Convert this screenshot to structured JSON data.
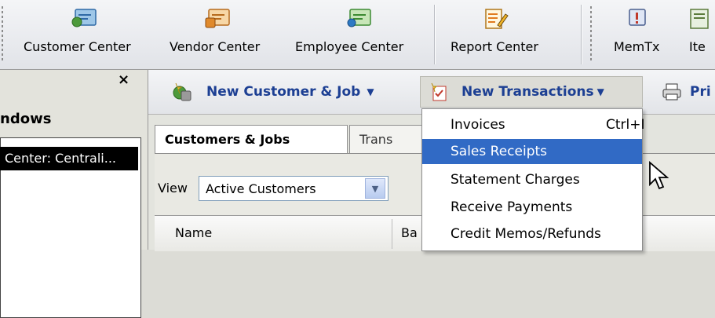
{
  "toolbar": {
    "items": [
      {
        "label": "Customer Center",
        "icon": "customer-card-icon"
      },
      {
        "label": "Vendor Center",
        "icon": "vendor-card-icon"
      },
      {
        "label": "Employee Center",
        "icon": "employee-card-icon"
      },
      {
        "label": "Report Center",
        "icon": "report-pencil-icon"
      },
      {
        "label": "MemTx",
        "icon": "memtx-icon"
      },
      {
        "label": "Ite",
        "icon": "item-list-icon"
      }
    ]
  },
  "left_pane": {
    "close_glyph": "×",
    "title": "ndows",
    "open_window": "Center: Centrali..."
  },
  "customer_bar": {
    "new_customer_job": "New Customer & Job",
    "new_transactions": "New Transactions",
    "print": "Pri",
    "dropdown_glyph": "▼"
  },
  "tabs": {
    "customers_jobs": "Customers & Jobs",
    "transactions": "Trans"
  },
  "view": {
    "label": "View",
    "selected": "Active Customers"
  },
  "list": {
    "columns": [
      "Name",
      "Ba"
    ]
  },
  "menu": {
    "items": [
      {
        "label": "Invoices",
        "shortcut": "Ctrl+I"
      },
      {
        "label": "Sales Receipts",
        "shortcut": ""
      },
      {
        "label": "Statement Charges",
        "shortcut": ""
      },
      {
        "label": "Receive Payments",
        "shortcut": ""
      },
      {
        "label": "Credit Memos/Refunds",
        "shortcut": ""
      }
    ],
    "highlighted_index": 1
  },
  "colors": {
    "link_blue": "#1c3f93",
    "selection_blue": "#316ac5"
  }
}
